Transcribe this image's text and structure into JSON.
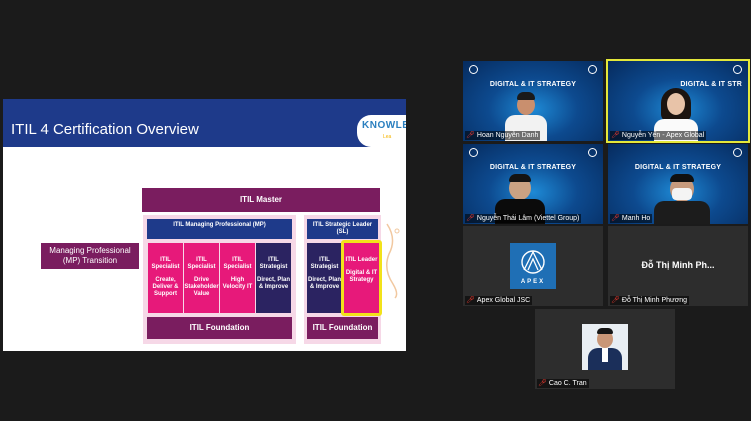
{
  "slide": {
    "title": "ITIL 4 Certification Overview",
    "logo_text": "KNOWLE",
    "logo_sub": "Lea",
    "mp_transition": "Managing Professional (MP) Transition",
    "itil_master": "ITIL Master",
    "mp_header": "ITIL Managing Professional (MP)",
    "sl_header": "ITIL Strategic Leader (SL)",
    "courses": [
      {
        "name": "ITIL Specialist",
        "desc": "Create, Deliver & Support"
      },
      {
        "name": "ITIL Specialist",
        "desc": "Drive Stakeholder Value"
      },
      {
        "name": "ITIL Specialist",
        "desc": "High Velocity IT"
      },
      {
        "name": "ITIL Strategist",
        "desc": "Direct, Plan & Improve"
      },
      {
        "name": "ITIL Strategist",
        "desc": "Direct, Plan & Improve"
      },
      {
        "name": "ITIL Leader",
        "desc": "Digital & IT Strategy"
      }
    ],
    "foundation": "ITIL Foundation"
  },
  "poster": {
    "title": "DIGITAL & IT STRATEGY",
    "title_cut": "DIGITAL & IT STR"
  },
  "participants": [
    {
      "name": "Hoan Nguyễn Danh"
    },
    {
      "name": "Nguyễn Yến - Apex Global"
    },
    {
      "name": "Nguyễn Thái Lâm (Viettel Group)"
    },
    {
      "name": "Manh Ho"
    },
    {
      "name": "Apex Global JSC"
    },
    {
      "name": "Đỗ Thị Minh Phương",
      "display": "Đỗ Thị Minh Ph..."
    },
    {
      "name": "Cao C. Tran"
    }
  ],
  "apex_logo_text": "APEX",
  "colors": {
    "accent": "#e4e83a",
    "mic_muted": "#ff3b30",
    "itil_blue": "#1e3a8a",
    "itil_pink": "#e7197a",
    "itil_plum": "#7a1d5f"
  },
  "icons": {
    "mic": "mic-muted-icon"
  }
}
